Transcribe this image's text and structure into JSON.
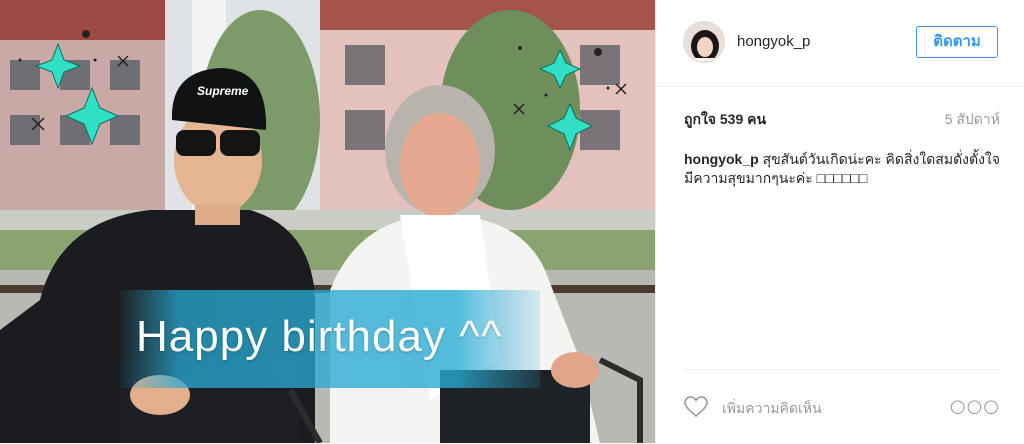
{
  "post": {
    "photo_caption_overlay": "Happy birthday ^^",
    "cap_logo_text": "Supreme",
    "colors": {
      "banner": "#28aad2",
      "sparkle": "#2fe0c4"
    }
  },
  "header": {
    "username": "hongyok_p",
    "follow_label": "ติดตาม",
    "follow_color": "#3897f0"
  },
  "stats": {
    "likes": "ถูกใจ 539 คน",
    "time_ago": "5 สัปดาห์"
  },
  "caption": {
    "user": "hongyok_p",
    "text": "สุขสันต์วันเกิดน่ะคะ คิดสิ่งใดสมดั่งตั้งใจ มีความสุขมากๆนะค่ะ □□□□□□"
  },
  "footer": {
    "like_icon": "heart-icon",
    "comment_placeholder": "เพิ่มความคิดเห็น",
    "more_icon": "more-options-icon",
    "more_glyph": "○○○"
  }
}
